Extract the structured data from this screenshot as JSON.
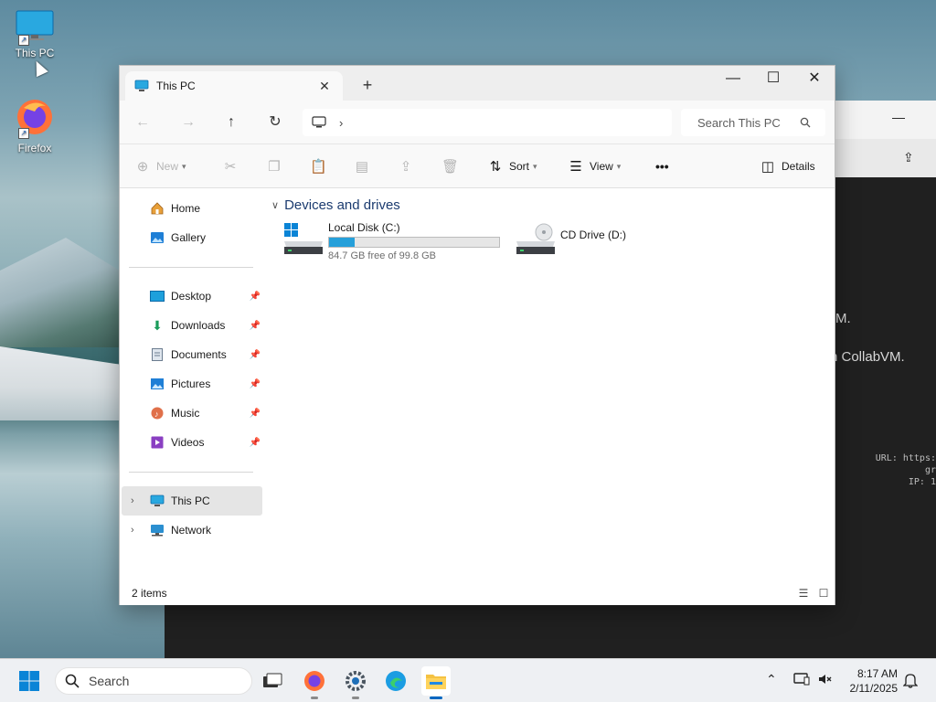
{
  "desktop": {
    "icons": [
      {
        "label": "This PC"
      },
      {
        "label": "Firefox"
      }
    ]
  },
  "background_window": {
    "text_line1": "M.",
    "text_line2": "n CollabVM.",
    "mono_line1": "URL: https:",
    "mono_line2": "gr",
    "mono_line3": "IP: 1"
  },
  "explorer": {
    "tab_title": "This PC",
    "tab_close": "✕",
    "new_tab": "+",
    "window_controls": {
      "minimize": "—",
      "maximize": "☐",
      "close": "✕"
    },
    "nav": {
      "back": "←",
      "forward": "→",
      "up": "↑",
      "refresh": "↻",
      "breadcrumb_chevron": "›"
    },
    "search_placeholder": "Search This PC",
    "commands": {
      "new": "New",
      "sort": "Sort",
      "view": "View",
      "more": "•••",
      "details": "Details"
    },
    "sidebar": {
      "top": [
        {
          "label": "Home"
        },
        {
          "label": "Gallery"
        }
      ],
      "pinned": [
        {
          "label": "Desktop"
        },
        {
          "label": "Downloads"
        },
        {
          "label": "Documents"
        },
        {
          "label": "Pictures"
        },
        {
          "label": "Music"
        },
        {
          "label": "Videos"
        }
      ],
      "locations": [
        {
          "label": "This PC",
          "selected": true
        },
        {
          "label": "Network"
        }
      ]
    },
    "group_title": "Devices and drives",
    "drives": [
      {
        "label": "Local Disk (C:)",
        "free_text": "84.7 GB free of 99.8 GB",
        "used_fraction": 0.151
      },
      {
        "label": "CD Drive (D:)"
      }
    ],
    "status": "2 items"
  },
  "taskbar": {
    "search_label": "Search",
    "time": "8:17 AM",
    "date": "2/11/2025"
  },
  "colors": {
    "accent": "#0067c0",
    "drive_bar": "#26a0da",
    "group_title": "#1b3b6f"
  }
}
